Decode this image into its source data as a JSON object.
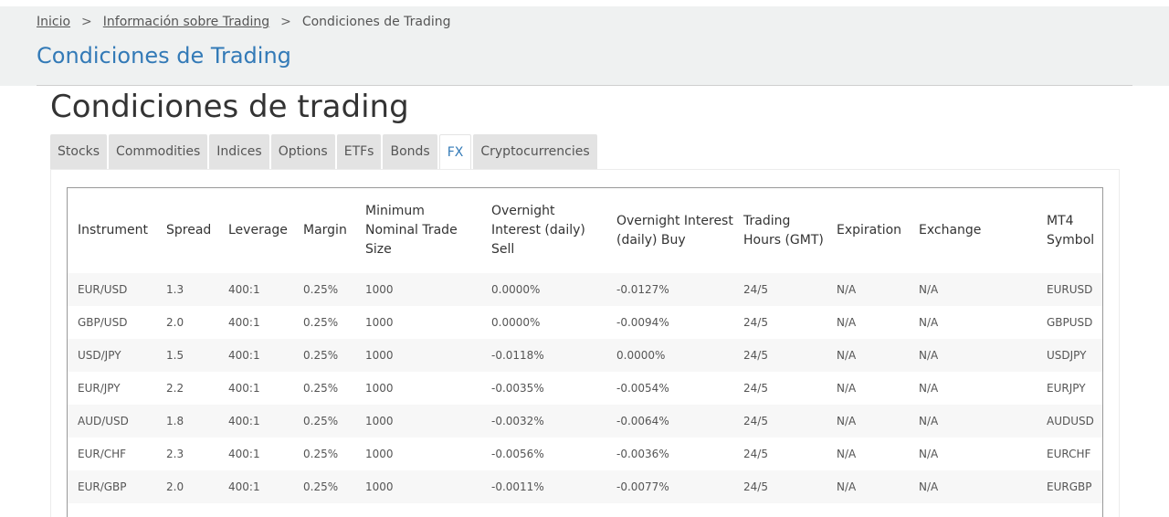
{
  "breadcrumb": {
    "items": [
      "Inicio",
      "Información sobre Trading",
      "Condiciones de Trading"
    ],
    "separator": ">"
  },
  "page": {
    "heading": "Condiciones de Trading",
    "section_title": "Condiciones de trading"
  },
  "tabs": {
    "items": [
      "Stocks",
      "Commodities",
      "Indices",
      "Options",
      "ETFs",
      "Bonds",
      "FX",
      "Cryptocurrencies"
    ],
    "active": "FX"
  },
  "table": {
    "headers": [
      "Instrument",
      "Spread",
      "Leverage",
      "Margin",
      "Minimum Nominal Trade Size",
      "Overnight Interest (daily) Sell",
      "Overnight Interest (daily) Buy",
      "Trading Hours (GMT)",
      "Expiration",
      "Exchange",
      "MT4 Symbol"
    ],
    "rows": [
      [
        "EUR/USD",
        "1.3",
        "400:1",
        "0.25%",
        "1000",
        "0.0000%",
        "-0.0127%",
        "24/5",
        "N/A",
        "N/A",
        "EURUSD"
      ],
      [
        "GBP/USD",
        "2.0",
        "400:1",
        "0.25%",
        "1000",
        "0.0000%",
        "-0.0094%",
        "24/5",
        "N/A",
        "N/A",
        "GBPUSD"
      ],
      [
        "USD/JPY",
        "1.5",
        "400:1",
        "0.25%",
        "1000",
        "-0.0118%",
        "0.0000%",
        "24/5",
        "N/A",
        "N/A",
        "USDJPY"
      ],
      [
        "EUR/JPY",
        "2.2",
        "400:1",
        "0.25%",
        "1000",
        "-0.0035%",
        "-0.0054%",
        "24/5",
        "N/A",
        "N/A",
        "EURJPY"
      ],
      [
        "AUD/USD",
        "1.8",
        "400:1",
        "0.25%",
        "1000",
        "-0.0032%",
        "-0.0064%",
        "24/5",
        "N/A",
        "N/A",
        "AUDUSD"
      ],
      [
        "EUR/CHF",
        "2.3",
        "400:1",
        "0.25%",
        "1000",
        "-0.0056%",
        "-0.0036%",
        "24/5",
        "N/A",
        "N/A",
        "EURCHF"
      ],
      [
        "EUR/GBP",
        "2.0",
        "400:1",
        "0.25%",
        "1000",
        "-0.0011%",
        "-0.0077%",
        "24/5",
        "N/A",
        "N/A",
        "EURGBP"
      ]
    ]
  },
  "colors": {
    "accent": "#337ab7",
    "header_band": "#eff1f1",
    "tab_inactive": "#e3e3e3"
  }
}
